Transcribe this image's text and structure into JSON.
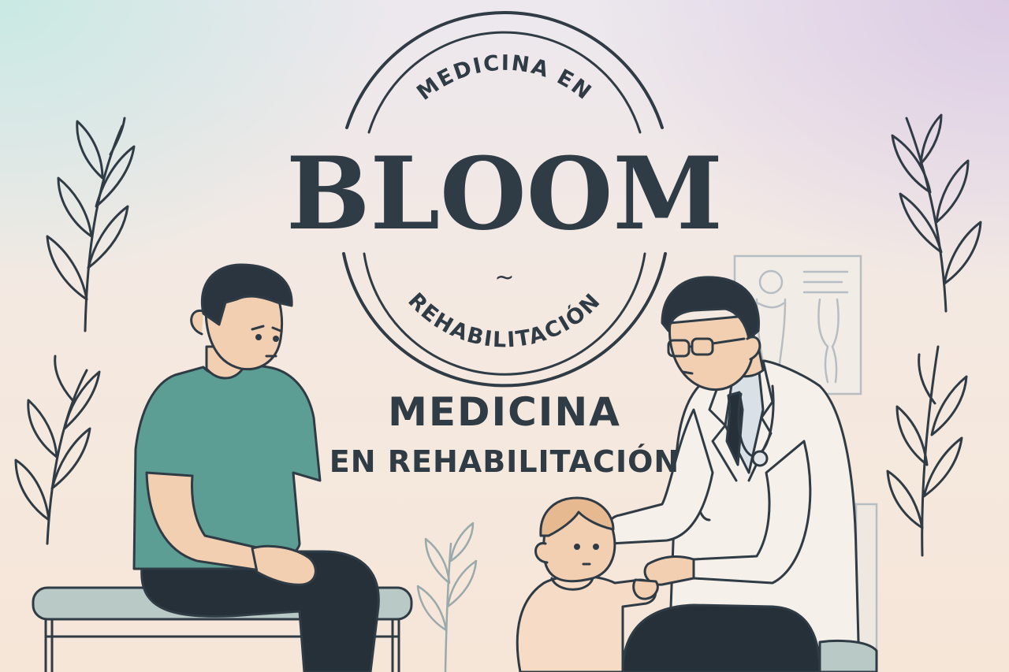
{
  "logo": {
    "top_text": "MEDICINA EN",
    "wordmark": "BLOOM",
    "bottom_text": "REHABILITACIÓN",
    "separator_glyph": "~"
  },
  "headline": {
    "line1": "MEDICINA",
    "line2": "EN REHABILITACIÓN"
  },
  "colors": {
    "ink": "#2f3b45",
    "teal_shirt": "#5c9e93",
    "skin": "#f3cfb2",
    "hair": "#2a3540",
    "coat": "#f5f0ea",
    "child_hair": "#e6b990",
    "bench": "#b9c9c6"
  },
  "icons": [
    "leaf-sprig-icon",
    "xray-chart-icon",
    "stethoscope-icon"
  ]
}
